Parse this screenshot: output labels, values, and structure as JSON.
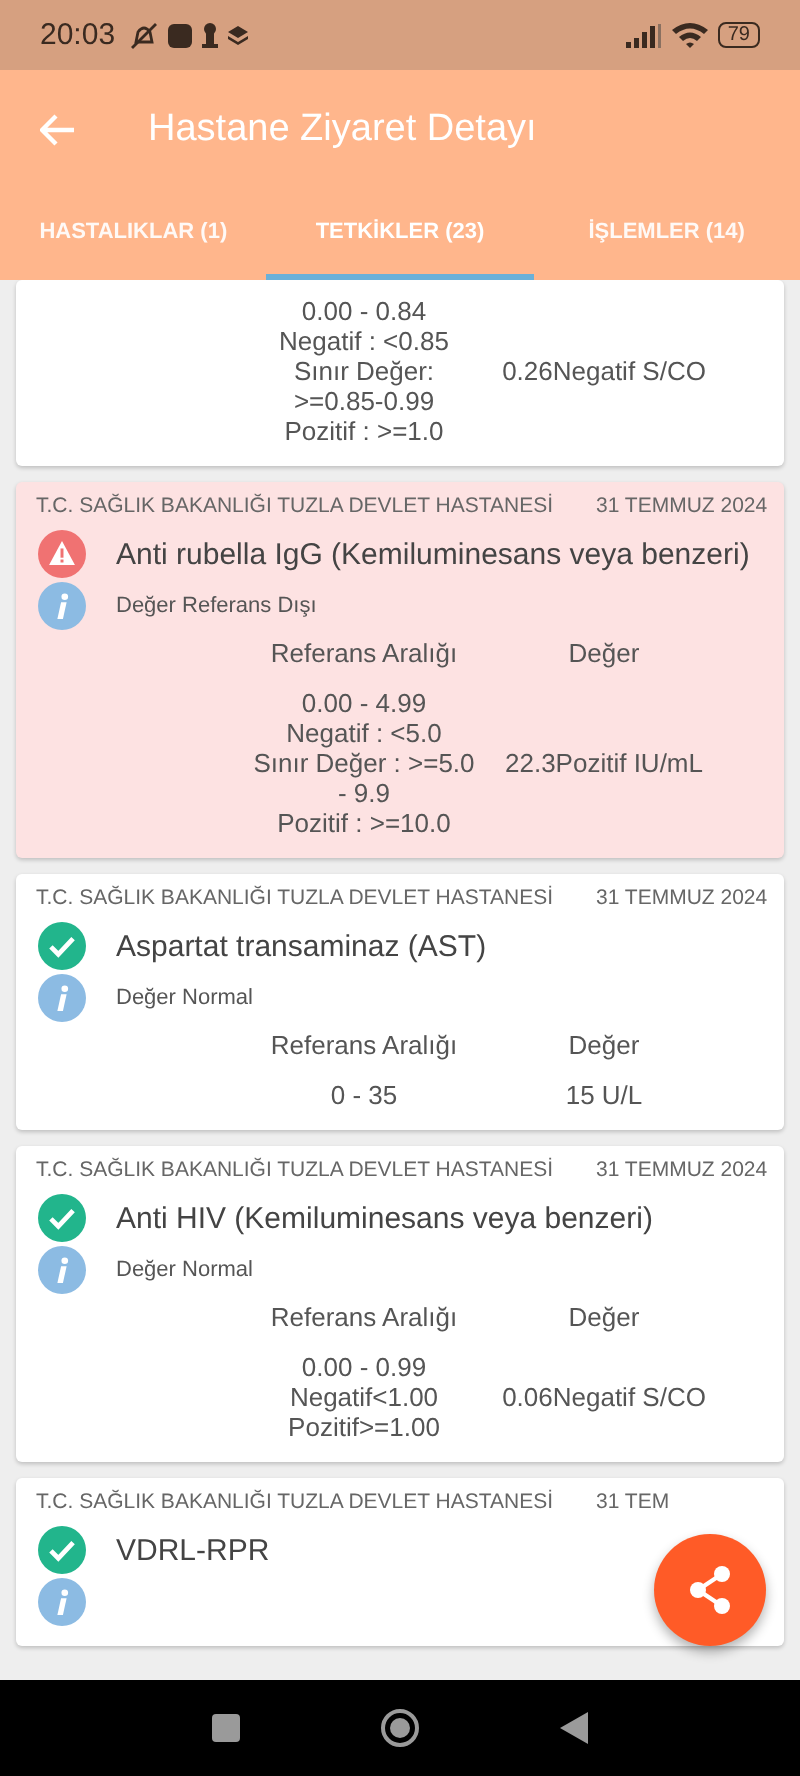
{
  "status_bar": {
    "time": "20:03",
    "battery": "79"
  },
  "app_bar": {
    "title": "Hastane Ziyaret Detayı"
  },
  "tabs": [
    {
      "label": "HASTALIKLAR (1)",
      "selected": false
    },
    {
      "label": "TETKİKLER (23)",
      "selected": true
    },
    {
      "label": "İŞLEMLER (14)",
      "selected": false
    }
  ],
  "tests": [
    {
      "kind": "normal",
      "reference_lines": [
        "0.00 - 0.84",
        "Negatif : <0.85",
        "Sınır Değer:",
        ">=0.85-0.99",
        "Pozitif : >=1.0"
      ],
      "value": "0.26Negatif S/CO"
    },
    {
      "kind": "warning",
      "hospital": "T.C. SAĞLIK BAKANLIĞI TUZLA DEVLET HASTANESİ",
      "date": "31 TEMMUZ 2024",
      "name": "Anti rubella IgG (Kemiluminesans veya benzeri)",
      "note": "Değer Referans Dışı",
      "reference_header": "Referans Aralığı",
      "value_header": "Değer",
      "reference_lines": [
        "0.00 - 4.99",
        "Negatif : <5.0",
        "Sınır Değer : >=5.0",
        "- 9.9",
        "Pozitif : >=10.0"
      ],
      "value": "22.3Pozitif IU/mL"
    },
    {
      "kind": "normal",
      "hospital": "T.C. SAĞLIK BAKANLIĞI TUZLA DEVLET HASTANESİ",
      "date": "31 TEMMUZ 2024",
      "name": "Aspartat transaminaz (AST)",
      "note": "Değer Normal",
      "reference_header": "Referans Aralığı",
      "value_header": "Değer",
      "reference_lines": [
        "0 - 35"
      ],
      "value": "15 U/L"
    },
    {
      "kind": "normal",
      "hospital": "T.C. SAĞLIK BAKANLIĞI TUZLA DEVLET HASTANESİ",
      "date": "31 TEMMUZ 2024",
      "name": "Anti HIV (Kemiluminesans veya benzeri)",
      "note": "Değer Normal",
      "reference_header": "Referans Aralığı",
      "value_header": "Değer",
      "reference_lines": [
        "0.00 - 0.99",
        "Negatif<1.00",
        "Pozitif>=1.00"
      ],
      "value": "0.06Negatif S/CO"
    },
    {
      "kind": "normal",
      "hospital": "T.C. SAĞLIK BAKANLIĞI TUZLA DEVLET HASTANESİ",
      "date": "31 TEM",
      "name": "VDRL-RPR"
    }
  ]
}
